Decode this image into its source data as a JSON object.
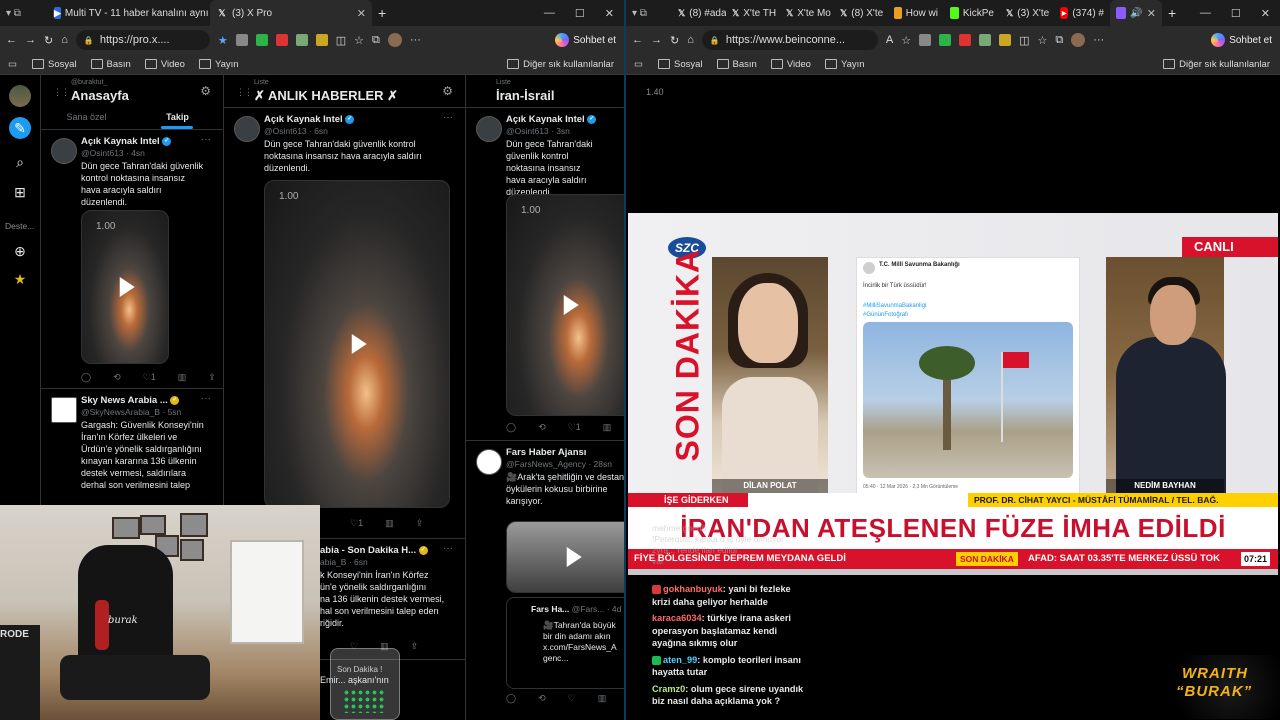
{
  "left_browser": {
    "tabs": [
      {
        "title": "Multi TV - 11 haber kanalını aynı a"
      },
      {
        "title": "(3) X Pro"
      }
    ],
    "address": "https://pro.x....",
    "chat_label": "Sohbet et",
    "bookmarks": [
      "Sosyal",
      "Basın",
      "Video",
      "Yayın"
    ],
    "bookmarks_right": "Diğer sık kullanılanlar"
  },
  "xpro": {
    "nav_label": "Deste...",
    "col1": {
      "handle_small": "@buraktut_",
      "title": "Anasayfa",
      "subtabs": [
        "Sana özel",
        "Takip"
      ],
      "tweets": [
        {
          "name": "Açık Kaynak Intel",
          "handle": "@Osint613 · 4sn",
          "text": "Dün gece Tahran'daki güvenlik\nkontrol noktasına insansız\nhava aracıyla saldırı\ndüzenlendi.",
          "speed": "1.00",
          "like_count": "1"
        },
        {
          "name": "Sky News Arabia ...",
          "handle": "@SkyNewsArabia_B · 5sn",
          "text": "Gargash: Güvenlik Konseyi'nin\nİran'ın Körfez ülkeleri ve\nÜrdün'e yönelik saldırganlığını\nkınayan kararına 136 ülkenin\ndestek vermesi, saldırılara\nderhal son verilmesini talep"
        }
      ]
    },
    "col2": {
      "small": "Liste",
      "title": "✗ ANLIK HABERLER ✗",
      "tweets": [
        {
          "name": "Açık Kaynak Intel",
          "handle": "@Osint613 · 6sn",
          "text": "Dün gece Tahran'daki güvenlik kontrol\nnoktasına insansız hava aracıyla saldırı\ndüzenlendi.",
          "speed": "1.00",
          "like_count": "1"
        },
        {
          "name": "abia - Son Dakika H...",
          "handle": "abia_B · 6sn",
          "text": "k Konseyi'nin İran'ın Körfez\nün'e yönelik saldırganlığını\nna 136 ülkenin destek vermesi,\nhal son verilmesini talep eden\nriğidir."
        },
        {
          "text": "Emir... aşkanı'nın"
        }
      ]
    },
    "col3": {
      "small": "Liste",
      "title": "İran-İsrail",
      "tweets": [
        {
          "name": "Açık Kaynak Intel",
          "handle": "@Osint613 · 3sn",
          "text": "Dün gece Tahran'daki\ngüvenlik kontrol\nnoktasına insansız\nhava aracıyla saldırı\ndüzenlendi.",
          "speed": "1.00",
          "like_count": "1"
        },
        {
          "name": "Fars Haber Ajansı",
          "handle": "@FarsNews_Agency · 28sn",
          "text": "🎥Arak'ta şehitliğin ve destan\nöykülerin kokusu birbirine\nkarışıyor.",
          "quote_name": "Fars Ha...",
          "quote_handle": "@Fars... · 4d",
          "quote_text": "🎥Tahran'da büyük\nbir din adamı akın\nx.com/FarsNews_A\ngenc..."
        }
      ]
    },
    "bottle_label": "Son Dakika !"
  },
  "webcam": {
    "mic_label": "RODE",
    "chair_logo": "burak"
  },
  "right_browser": {
    "tabs": [
      {
        "title": "(8) #ada"
      },
      {
        "title": "X'te TH"
      },
      {
        "title": "X'te Mo"
      },
      {
        "title": "(8) X'te"
      },
      {
        "title": "How wi"
      },
      {
        "title": "KickPe"
      },
      {
        "title": "(3) X'te"
      },
      {
        "title": "(374) #"
      }
    ],
    "address": "https://www.beinconne...",
    "chat_label": "Sohbet et",
    "bookmarks": [
      "Sosyal",
      "Basın",
      "Video",
      "Yayın"
    ],
    "bookmarks_right": "Diğer sık kullanılanlar",
    "speed": "1.40"
  },
  "tv": {
    "logo": "SZC",
    "son_dakika": "SON DAKİKA",
    "live": "CANLI",
    "anchor_left": "DİLAN POLAT",
    "anchor_right": "NEDİM BAYHAN",
    "card_name": "T.C. Millî Savunma Bakanlığı",
    "card_text": "İncirlik bir Türk üssüdür!",
    "card_hashtags": "#MilliSavunmaBakanligi\n#GününFotoğrafı",
    "card_meta": "05:40 · 12 Mar 2026 · 2,3 Mn Görüntüleme",
    "segment": "İŞE GİDERKEN",
    "guests": "PROF. DR. CİHAT YAYCI - MÜSTÂFİ TÜMAMİRAL / TEL. BAĞ.",
    "headline": "İRAN'DAN ATEŞLENEN FÜZE İMHA EDİLDİ",
    "crawl_left": "FİYE BÖLGESİNDE DEPREM MEYDANA GELDİ",
    "crawl_badge": "SON DAKİKA",
    "crawl_right": "AFAD: SAAT 03.35'TE MERKEZ ÜSSÜ TOK",
    "clock": "07:21"
  },
  "chat": {
    "faded": "mehmetgnen6: ...\n!Peterquilt: kanka o iş öyle olmuyor\nzyra... rende ilan edildi\nvar",
    "messages": [
      {
        "user": "gokhanbuyuk",
        "text": "yani bi fezleke\nkrizi daha geliyor herhalde",
        "color": "red"
      },
      {
        "user": "karaca6034",
        "text": "türkiye irana askeri\noperasyon başlatamaz kendi\nayağına sıkmış olur",
        "color": "red"
      },
      {
        "user": "aten_99",
        "text": "komplo teorileri insanı\nhayatta tutar",
        "color": "blue"
      },
      {
        "user": "Cramz0",
        "text": "olum gece sirene uyandık\nbiz nasıl daha açıklama yok ?",
        "color": "green"
      }
    ]
  },
  "brand": {
    "line1": "WRAITH",
    "line2": "“BURAK”"
  }
}
